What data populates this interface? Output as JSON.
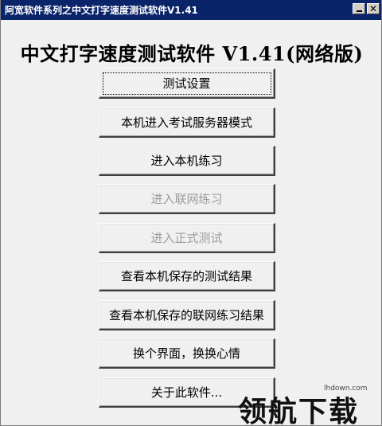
{
  "window": {
    "title": "阿宽软件系列之中文打字速度测试软件V1.41",
    "close_glyph": "✕"
  },
  "heading": "中文打字速度测试软件 V1.41(网络版)",
  "buttons": [
    {
      "label": "测试设置",
      "enabled": true,
      "focused": true
    },
    {
      "label": "本机进入考试服务器模式",
      "enabled": true
    },
    {
      "label": "进入本机练习",
      "enabled": true
    },
    {
      "label": "进入联网练习",
      "enabled": false
    },
    {
      "label": "进入正式测试",
      "enabled": false
    },
    {
      "label": "查看本机保存的测试结果",
      "enabled": true
    },
    {
      "label": "查看本机保存的联网练习结果",
      "enabled": true
    },
    {
      "label": "换个界面，换换心情",
      "enabled": true
    },
    {
      "label": "关于此软件...",
      "enabled": true
    }
  ],
  "watermark": {
    "site": "lhdown.com",
    "brand": "领航下载"
  }
}
